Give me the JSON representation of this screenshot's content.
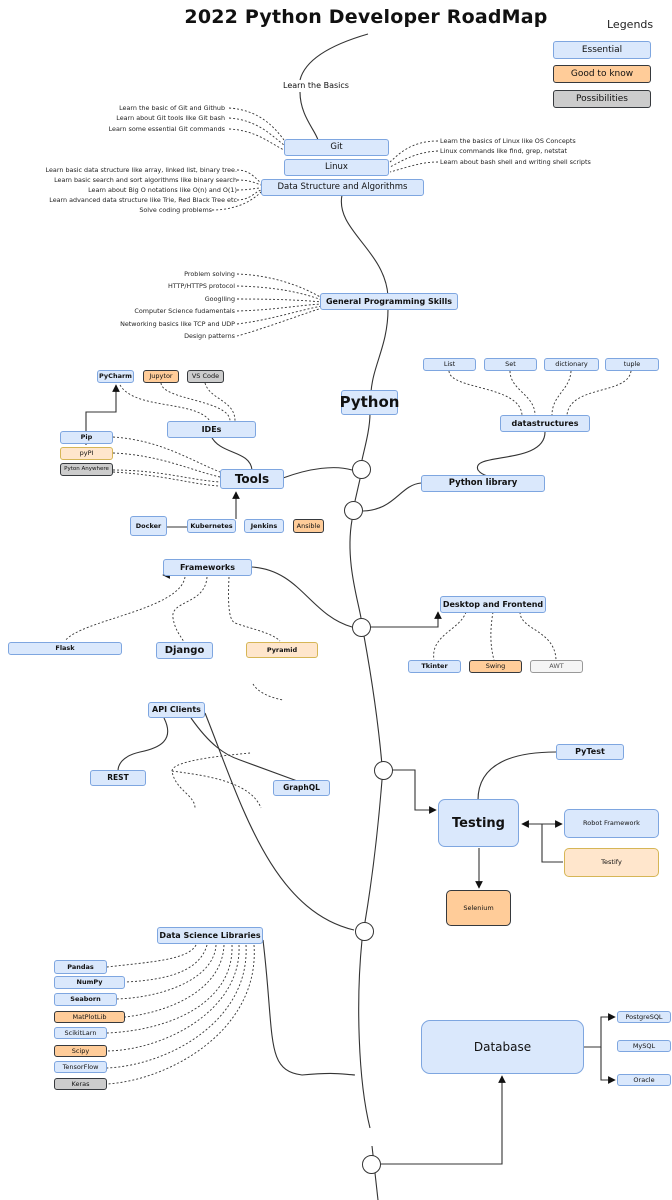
{
  "title": "2022 Python Developer RoadMap",
  "legend": {
    "title": "Legends",
    "items": [
      {
        "label": "Essential",
        "color": "#dae8fc"
      },
      {
        "label": "Good to know",
        "color": "#ffcc99"
      },
      {
        "label": "Possibilities",
        "color": "#cccccc"
      }
    ]
  },
  "basics": {
    "label": "Learn the Basics",
    "git": {
      "label": "Git",
      "notes": [
        "Learn the basic of Git and Github",
        "Learn about Git tools like Git bash",
        "Learn some essential Git commands"
      ]
    },
    "linux": {
      "label": "Linux",
      "notes": [
        "Learn the basics of Linux like OS Concepts",
        "Linux commands like find, grep, netstat",
        "Learn about bash shell and writing shell scripts"
      ]
    },
    "dsa": {
      "label": "Data Structure and Algorithms",
      "notes": [
        "Learn basic data structure like array, linked list, binary tree.",
        "Learn basic search and sort algorithms like binary search",
        "Learn about Big O notations like O(n) and O(1)",
        "Learn advanced data structure like Trie, Red Black Tree etc",
        "Solve coding problems"
      ]
    }
  },
  "general_skills": {
    "label": "General Programming Skills",
    "notes": [
      "Problem solving",
      "HTTP/HTTPS protocol",
      "Googlling",
      "Computer Science fudamentals",
      "Networking basics like TCP and UDP",
      "Design patterns"
    ]
  },
  "python": {
    "label": "Python"
  },
  "datastructures": {
    "label": "datastructures",
    "items": [
      "List",
      "Set",
      "dictionary",
      "tuple"
    ]
  },
  "python_library": {
    "label": "Python library"
  },
  "tools": {
    "label": "Tools",
    "ides": {
      "label": "IDEs",
      "items": [
        "PyCharm",
        "Jupytor",
        "VS Code"
      ]
    },
    "packages": [
      "Pip",
      "pyPI",
      "Pyton Anywhere"
    ],
    "devops": [
      "Docker",
      "Kubernetes",
      "Jenkins",
      "Ansible"
    ]
  },
  "frameworks": {
    "label": "Frameworks",
    "items": [
      "Flask",
      "Django",
      "Pyramid"
    ]
  },
  "desktop": {
    "label": "Desktop and Frontend",
    "items": [
      "Tkinter",
      "Swing",
      "AWT"
    ]
  },
  "api_clients": {
    "label": "API Clients",
    "items": [
      "REST",
      "GraphQL"
    ]
  },
  "testing": {
    "label": "Testing",
    "items": [
      "PyTest",
      "Robot Framework",
      "Testify",
      "Selenium"
    ]
  },
  "data_science": {
    "label": "Data Science Libraries",
    "items": [
      "Pandas",
      "NumPy",
      "Seaborn",
      "MatPlotLib",
      "ScikitLarn",
      "Scipy",
      "TensorFlow",
      "Keras"
    ]
  },
  "database": {
    "label": "Database",
    "items": [
      "PostgreSQL",
      "MySQL",
      "Oracle"
    ]
  }
}
